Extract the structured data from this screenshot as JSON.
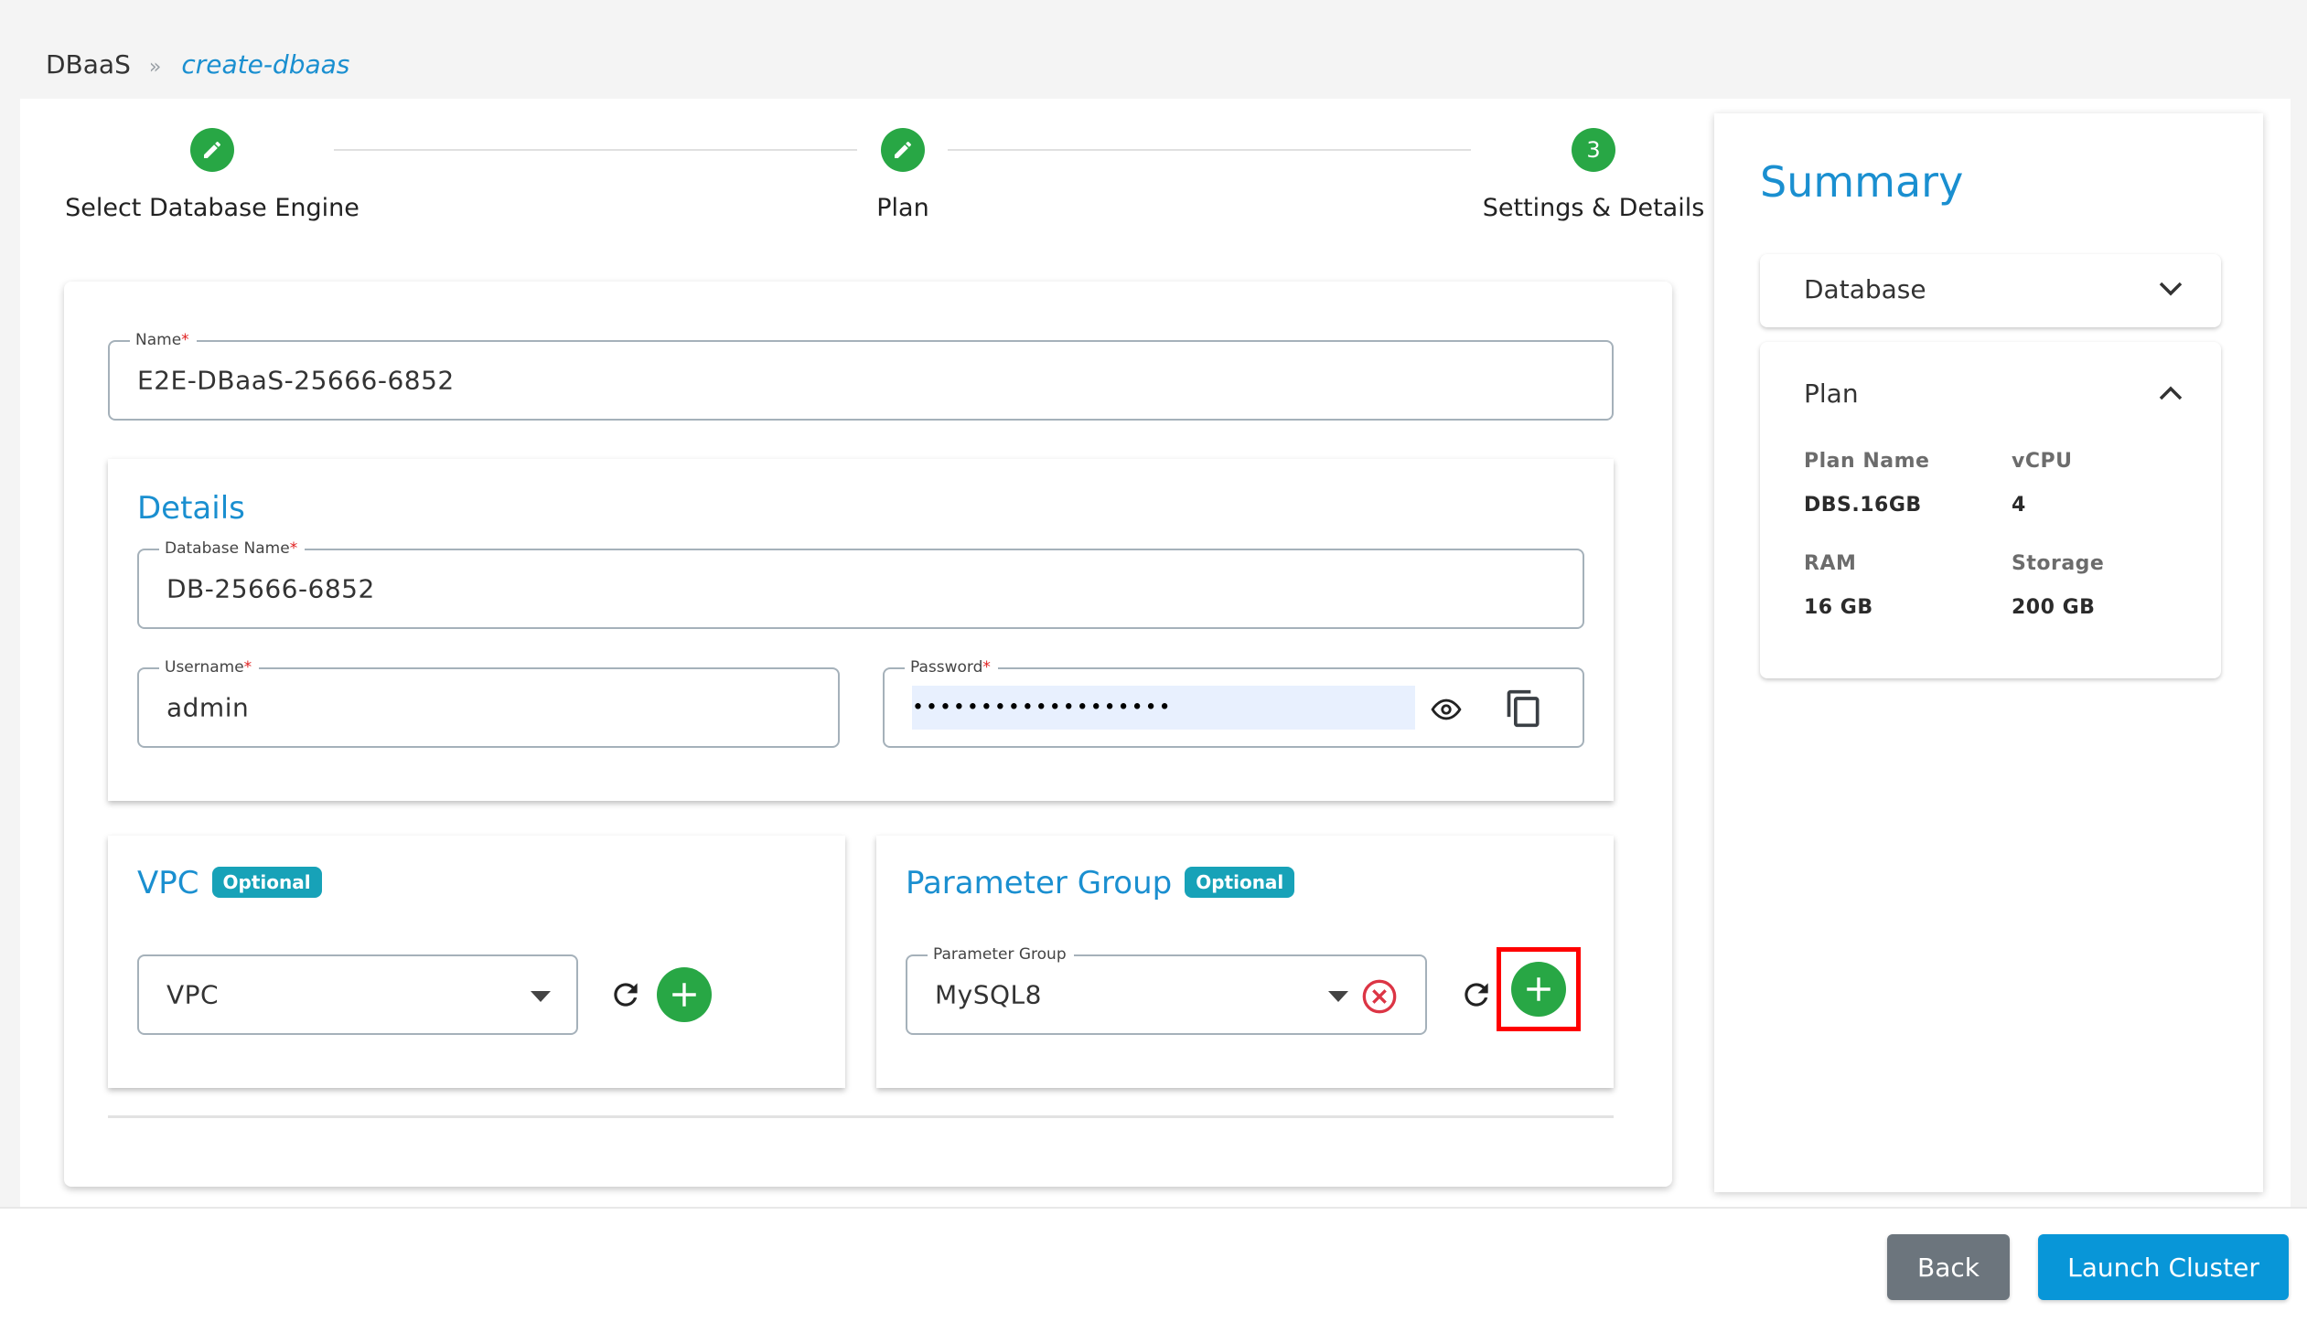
{
  "breadcrumb": {
    "root": "DBaaS",
    "separator": "»",
    "current": "create-dbaas"
  },
  "stepper": {
    "steps": [
      {
        "label": "Select Database Engine",
        "state": "completed",
        "icon": "pencil-icon"
      },
      {
        "label": "Plan",
        "state": "completed",
        "icon": "pencil-icon"
      },
      {
        "label": "Settings & Details",
        "state": "active",
        "number": "3"
      }
    ]
  },
  "form": {
    "name": {
      "label": "Name",
      "required_mark": "*",
      "value": "E2E-DBaaS-25666-6852"
    },
    "details": {
      "title": "Details",
      "database_name": {
        "label": "Database Name",
        "required_mark": "*",
        "value": "DB-25666-6852"
      },
      "username": {
        "label": "Username",
        "required_mark": "*",
        "value": "admin"
      },
      "password": {
        "label": "Password",
        "required_mark": "*",
        "masked_value": "•••••••••••••••••••",
        "show_icon": "eye-icon",
        "copy_icon": "copy-icon"
      }
    },
    "vpc": {
      "title": "VPC",
      "badge": "Optional",
      "select_placeholder": "VPC",
      "refresh_icon": "refresh-icon",
      "add_icon": "plus-icon"
    },
    "parameter_group": {
      "title": "Parameter Group",
      "badge": "Optional",
      "field_label": "Parameter Group",
      "value": "MySQL8",
      "clear_icon": "clear-circle-icon",
      "refresh_icon": "refresh-icon",
      "add_icon": "plus-icon"
    }
  },
  "summary": {
    "title": "Summary",
    "sections": [
      {
        "title": "Database",
        "expanded": false
      },
      {
        "title": "Plan",
        "expanded": true,
        "fields": [
          {
            "label": "Plan Name",
            "value": "DBS.16GB"
          },
          {
            "label": "vCPU",
            "value": "4"
          },
          {
            "label": "RAM",
            "value": "16 GB"
          },
          {
            "label": "Storage",
            "value": "200 GB"
          }
        ]
      }
    ]
  },
  "footer": {
    "back_label": "Back",
    "launch_label": "Launch Cluster"
  },
  "colors": {
    "accent": "#1a8fd0",
    "success": "#28a745",
    "badge": "#17a2b8",
    "danger": "#dc3545",
    "secondary": "#6c757d",
    "primary_button": "#0896d8",
    "highlight": "#ff0000"
  }
}
